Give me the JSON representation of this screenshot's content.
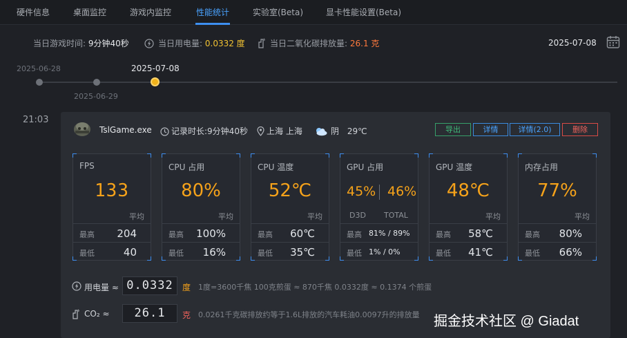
{
  "tabs": [
    {
      "label": "硬件信息",
      "active": false
    },
    {
      "label": "桌面监控",
      "active": false
    },
    {
      "label": "游戏内监控",
      "active": false
    },
    {
      "label": "性能统计",
      "active": true
    },
    {
      "label": "实验室(Beta)",
      "active": false
    },
    {
      "label": "显卡性能设置(Beta)",
      "active": false
    }
  ],
  "summary": {
    "play_time_label": "当日游戏时间:",
    "play_time_value": "9分钟40秒",
    "power_label": "当日用电量:",
    "power_value": "0.0332 度",
    "co2_label": "当日二氧化碳排放量:",
    "co2_value": "26.1 克",
    "selected_date": "2025-07-08"
  },
  "timeline": {
    "dates": [
      "2025-06-28",
      "2025-06-29",
      "2025-07-08"
    ],
    "active_index": 2
  },
  "record": {
    "time": "21:03",
    "game": "TslGame.exe",
    "duration": "记录时长:9分钟40秒",
    "location": "上海 上海",
    "weather": "阴",
    "temperature": "29℃",
    "buttons": {
      "export": "导出",
      "detail": "详情",
      "detail2": "详情(2.0)",
      "delete": "删除"
    },
    "metrics": [
      {
        "name": "FPS",
        "value": "133",
        "avg_label": "平均",
        "max_label": "最高",
        "max": "204",
        "min_label": "最低",
        "min": "40"
      },
      {
        "name": "CPU 占用",
        "value": "80%",
        "avg_label": "平均",
        "max_label": "最高",
        "max": "100%",
        "min_label": "最低",
        "min": "16%"
      },
      {
        "name": "CPU 温度",
        "value": "52℃",
        "avg_label": "平均",
        "max_label": "最高",
        "max": "60℃",
        "min_label": "最低",
        "min": "35℃"
      },
      {
        "name": "GPU 占用",
        "d3d": "45%",
        "total": "46%",
        "d3d_label": "D3D",
        "total_label": "TOTAL",
        "max_label": "最高",
        "max": "81%  /  89%",
        "min_label": "最低",
        "min": "1%  /  0%"
      },
      {
        "name": "GPU 温度",
        "value": "48℃",
        "avg_label": "平均",
        "max_label": "最高",
        "max": "58℃",
        "min_label": "最低",
        "min": "41℃"
      },
      {
        "name": "内存占用",
        "value": "77%",
        "avg_label": "平均",
        "max_label": "最高",
        "max": "80%",
        "min_label": "最低",
        "min": "66%"
      }
    ],
    "power": {
      "label": "用电量 ≈",
      "value": "0.0332",
      "unit": "度",
      "note": "1度=3600千焦    100克煎蛋 ≈ 870千焦    0.0332度 ≈ 0.1374 个煎蛋"
    },
    "co2": {
      "label": "CO₂ ≈",
      "value": "26.1",
      "unit": "克",
      "note": "0.0261千克碳排放约等于1.6L排放的汽车耗油0.0097升的排放量"
    }
  },
  "watermark": "掘金技术社区 @ Giadat",
  "colors": {
    "accent": "#3d8ff0",
    "value_orange": "#f5a21a",
    "power_yellow": "#f1c232",
    "co2_orange": "#ff7a3d"
  }
}
